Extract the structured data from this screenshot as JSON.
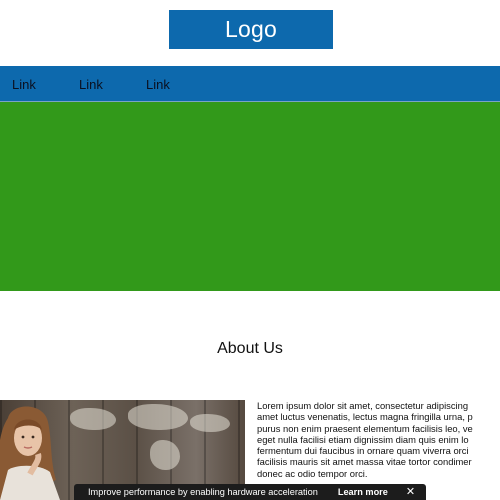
{
  "header": {
    "logo_label": "Logo"
  },
  "nav": {
    "links": [
      "Link",
      "Link",
      "Link"
    ]
  },
  "about": {
    "title": "About Us",
    "paragraph_lines": [
      "Lorem ipsum dolor sit amet, consectetur adipiscing",
      "amet luctus venenatis, lectus magna fringilla urna, p",
      "purus non enim praesent elementum facilisis leo, ve",
      "eget nulla facilisi etiam dignissim diam quis enim lo",
      "fermentum dui faucibus in ornare quam viverra orci",
      "facilisis mauris sit amet massa vitae tortor condimer",
      "donec ac odio tempor orci."
    ]
  },
  "toast": {
    "message": "Improve performance by enabling hardware acceleration",
    "action_label": "Learn more",
    "close_glyph": "✕"
  },
  "colors": {
    "brand_blue": "#0d69ad",
    "hero_green": "#32991a",
    "toast_bg": "#1c1c1c"
  },
  "icons": {
    "toast_close": "close-icon"
  }
}
